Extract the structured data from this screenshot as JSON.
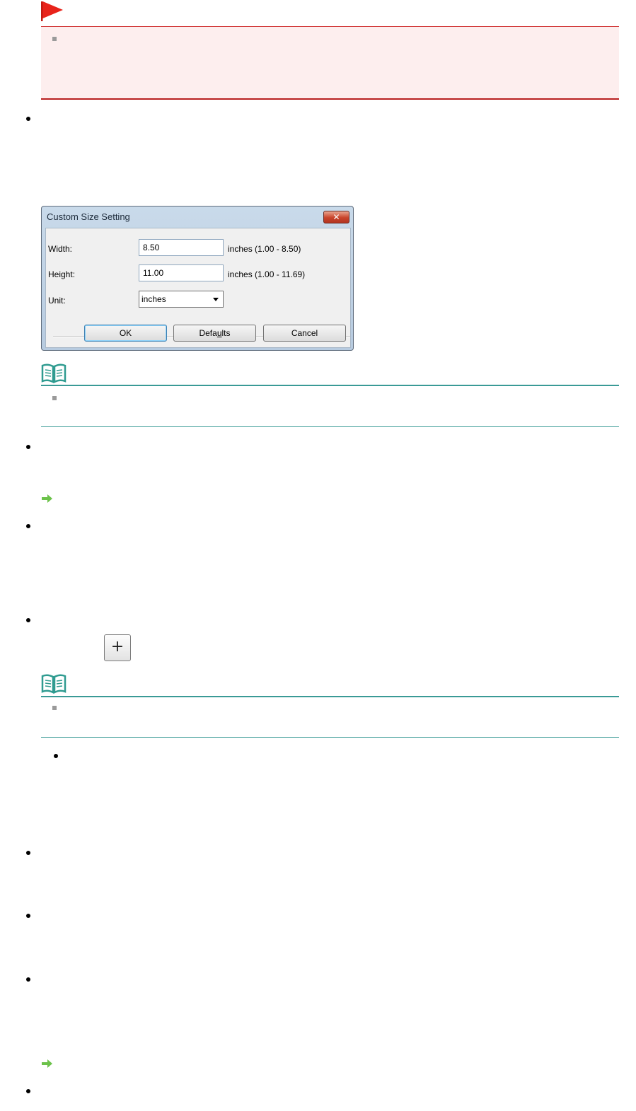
{
  "dialog": {
    "title": "Custom Size Setting",
    "close_glyph": "✕",
    "width_label": "Width:",
    "width_value": "8.50",
    "width_range": "inches (1.00 - 8.50)",
    "height_label": "Height:",
    "height_value": "11.00",
    "height_range": "inches (1.00 - 11.69)",
    "unit_label": "Unit:",
    "unit_value": "inches",
    "ok_label": "OK",
    "defaults_pre": "Defa",
    "defaults_accel": "u",
    "defaults_post": "lts",
    "cancel_label": "Cancel"
  },
  "plus_button": {
    "glyph": "+"
  },
  "colors": {
    "important_flag": "#e8231a",
    "important_bg": "#fdeeee",
    "important_border": "#b81f1f",
    "note_line": "#3a9a96",
    "note_icon": "#2f9b90",
    "link_arrow": "#6cc24a"
  },
  "icons": {
    "important": "flag-icon",
    "note": "book-icon",
    "link": "arrow-right-icon",
    "close": "close-icon",
    "dropdown": "chevron-down-icon",
    "plus": "plus-icon"
  }
}
